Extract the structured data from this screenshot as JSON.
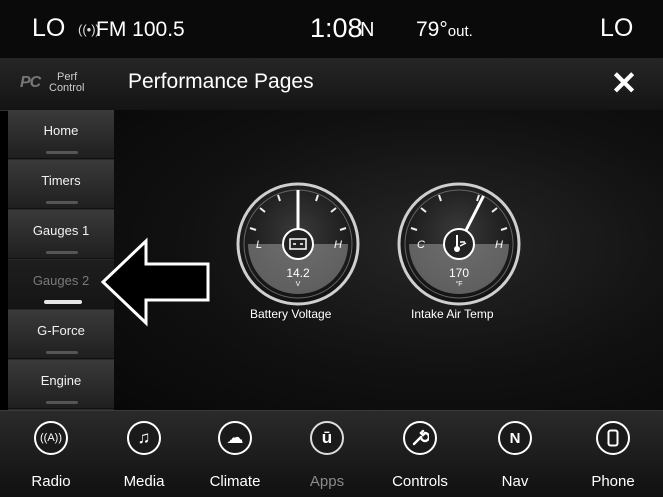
{
  "status_bar": {
    "left_temp_setting": "LO",
    "radio_icon": "radio-signal-icon",
    "station": "FM 100.5",
    "time": "1:08",
    "compass": "N",
    "outside_temp": "79°",
    "outside_suffix": "out.",
    "right_temp_setting": "LO"
  },
  "title_bar": {
    "logo": "PC",
    "logo_line1": "Perf",
    "logo_line2": "Control",
    "title": "Performance Pages",
    "close_icon": "close-icon",
    "close_glyph": "✕"
  },
  "sidebar": {
    "items": [
      {
        "label": "Home"
      },
      {
        "label": "Timers"
      },
      {
        "label": "Gauges 1"
      },
      {
        "label": "Gauges 2",
        "active": true
      },
      {
        "label": "G-Force"
      },
      {
        "label": "Engine"
      }
    ]
  },
  "gauges": [
    {
      "name": "Battery Voltage",
      "value": "14.2",
      "unit": "V",
      "low": "L",
      "high": "H",
      "icon": "battery-icon",
      "level": 0.5
    },
    {
      "name": "Intake Air Temp",
      "value": "170",
      "unit": "°F",
      "low": "C",
      "high": "H",
      "icon": "thermometer-icon",
      "level": 0.65
    }
  ],
  "dock": {
    "items": [
      {
        "label": "Radio",
        "icon": "radio-icon",
        "glyph": "((A))"
      },
      {
        "label": "Media",
        "icon": "music-note-icon",
        "glyph": "♫"
      },
      {
        "label": "Climate",
        "icon": "climate-icon",
        "glyph": "☁"
      },
      {
        "label": "Apps",
        "icon": "apps-icon",
        "glyph": "ū",
        "dimmed": true
      },
      {
        "label": "Controls",
        "icon": "wrench-icon",
        "glyph": "🔧"
      },
      {
        "label": "Nav",
        "icon": "compass-icon",
        "glyph": "N"
      },
      {
        "label": "Phone",
        "icon": "phone-icon",
        "glyph": "▯"
      }
    ]
  }
}
